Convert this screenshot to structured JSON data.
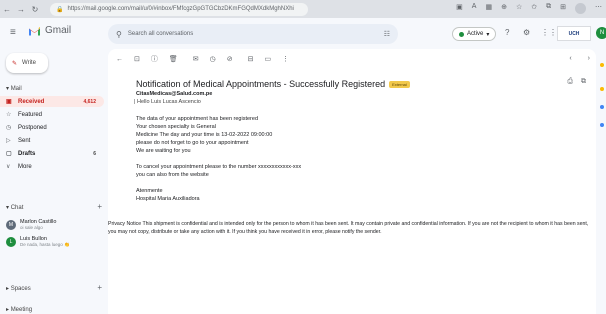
{
  "browser": {
    "url": "https://mail.google.com/mail/u/0/#inbox/FMfcgzGpGTGCbzDKmFGQdMXdkMghNXhi"
  },
  "gmail": {
    "app_name": "Gmail",
    "search_placeholder": "Search all conversations",
    "status": "Active",
    "org_logo": "UCH"
  },
  "sidebar": {
    "compose_label": "Write",
    "mail_section": "Mail",
    "items": [
      {
        "label": "Received",
        "count": "4,612",
        "icon": "inbox-icon"
      },
      {
        "label": "Featured",
        "count": "",
        "icon": "star-icon"
      },
      {
        "label": "Postponed",
        "count": "",
        "icon": "clock-icon"
      },
      {
        "label": "Sent",
        "count": "",
        "icon": "send-icon"
      },
      {
        "label": "Drafts",
        "count": "6",
        "icon": "draft-icon"
      },
      {
        "label": "More",
        "count": "",
        "icon": "chevron-down-icon"
      }
    ],
    "chat_section": "Chat",
    "contacts": [
      {
        "name": "Marlon Castillo",
        "status": "oi sale algo",
        "color": "#5f6b7a",
        "initial": "M"
      },
      {
        "name": "Luis Bullon",
        "status": "De nada, hasta luego 👏",
        "color": "#1e8e3e",
        "initial": "L"
      }
    ],
    "spaces_section": "Spaces",
    "meeting_section": "Meeting"
  },
  "email": {
    "subject": "Notification of Medical Appointments - Successfully Registered",
    "external_label": "External",
    "sender": "CitasMedicas@Salud.com.pe",
    "greeting": "Hello Luis Lucas Ascencio",
    "lines": [
      "The data of your appointment has been registered",
      "Your chosen specialty is General",
      "Medicine The day and your time is 13-02-2022 09:00:00",
      "please do not forget to go to your appointment",
      "We are waiting for you",
      "To cancel your appointment please to the number xxxxxxxxxxxx-xxx",
      "you can also from the website",
      "Atenmente",
      "Hospital Maria Auxiliadora"
    ],
    "privacy": "Privacy Notice This shipment is confidential and is intended only for the person to whom it has been sent. It may contain private and confidential information. If you are not the recipient to whom it has been sent, you may not copy, distribute or take any action with it. If you think you have received it in error, please notify the sender."
  },
  "colors": {
    "accent_red": "#c5221f",
    "active_green": "#1e8e3e",
    "external_badge": "#f2c94c"
  }
}
